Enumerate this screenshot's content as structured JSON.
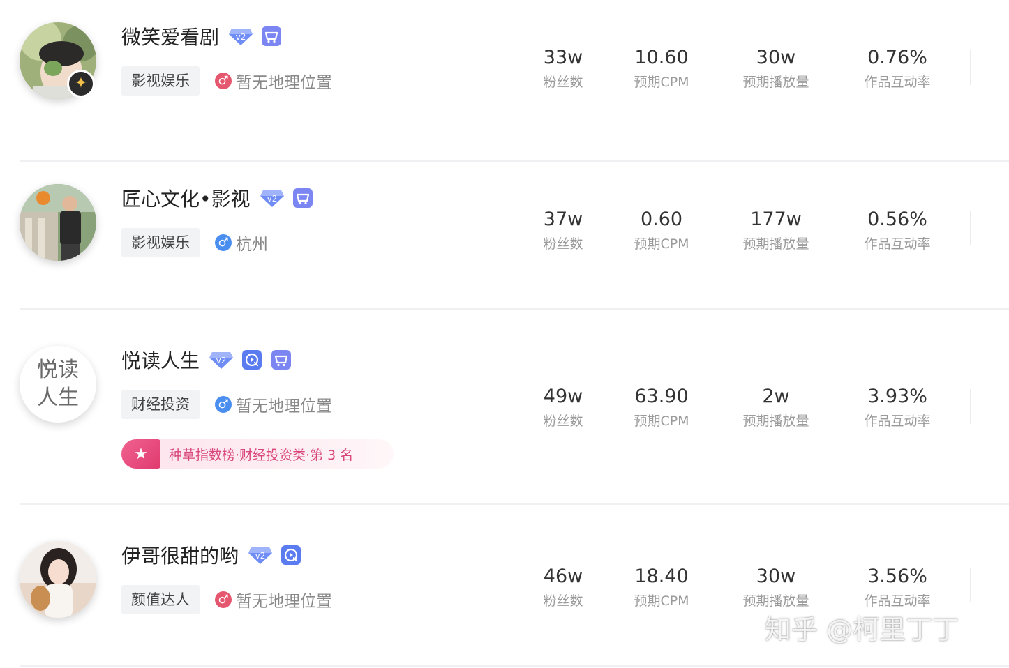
{
  "creators": [
    {
      "name": "微笑爱看剧",
      "badges": [
        "v2-badge",
        "shop-cart-icon"
      ],
      "category": "影视娱乐",
      "gender": "female",
      "location": "暂无地理位置",
      "avatar_initials": "",
      "rank_text": "",
      "fans": "33w",
      "cpm": "10.60",
      "plays": "30w",
      "engagement": "0.76%"
    },
    {
      "name": "匠心文化•影视",
      "badges": [
        "v2-badge",
        "shop-cart-icon"
      ],
      "category": "影视娱乐",
      "gender": "male",
      "location": "杭州",
      "avatar_initials": "",
      "rank_text": "",
      "fans": "37w",
      "cpm": "0.60",
      "plays": "177w",
      "engagement": "0.56%"
    },
    {
      "name": "悦读人生",
      "badges": [
        "v2-badge",
        "video-play-icon",
        "shop-cart-icon"
      ],
      "category": "财经投资",
      "gender": "male",
      "location": "暂无地理位置",
      "avatar_text_line1": "悦读",
      "avatar_text_line2": "人生",
      "rank_text": "种草指数榜·财经投资类·第 3 名",
      "fans": "49w",
      "cpm": "63.90",
      "plays": "2w",
      "engagement": "3.93%"
    },
    {
      "name": "伊哥很甜的哟",
      "badges": [
        "v2-badge",
        "video-play-icon"
      ],
      "category": "颜值达人",
      "gender": "female",
      "location": "暂无地理位置",
      "avatar_initials": "",
      "rank_text": "",
      "fans": "46w",
      "cpm": "18.40",
      "plays": "30w",
      "engagement": "3.56%"
    }
  ],
  "labels": {
    "fans": "粉丝数",
    "cpm": "预期CPM",
    "plays": "预期播放量",
    "engagement": "作品互动率"
  },
  "watermark": "知乎 @柯里丁丁",
  "colors": {
    "female": "#e5566f",
    "male": "#4a8ff0",
    "v2_badge": "#6f8df5",
    "shop_icon": "#7b86f2",
    "rank_accent": "#e03a6f"
  }
}
